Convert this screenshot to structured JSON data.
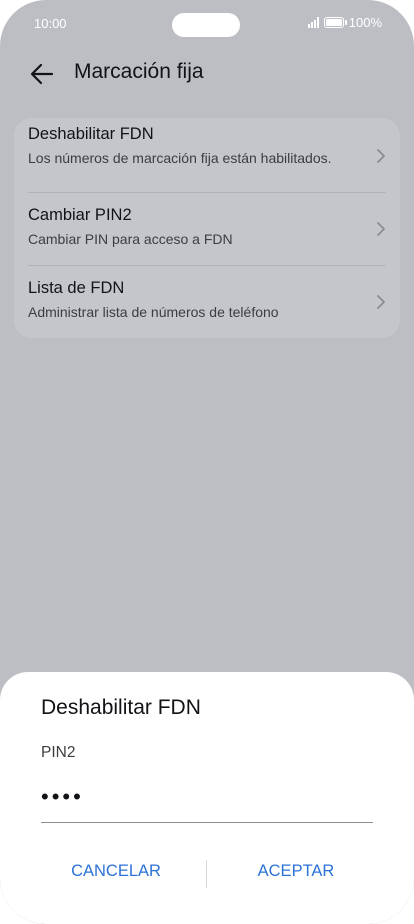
{
  "status_bar": {
    "time": "10:00",
    "battery": "100%"
  },
  "header": {
    "title": "Marcación fija",
    "back_icon": "arrow-left-icon"
  },
  "settings": {
    "items": [
      {
        "title": "Deshabilitar FDN",
        "subtitle": "Los números de marcación fija están habilitados."
      },
      {
        "title": "Cambiar PIN2",
        "subtitle": "Cambiar PIN para acceso a FDN"
      },
      {
        "title": "Lista de FDN",
        "subtitle": "Administrar lista de números de teléfono"
      }
    ]
  },
  "dialog": {
    "title": "Deshabilitar FDN",
    "field_label": "PIN2",
    "field_value": "••••",
    "cancel_label": "CANCELAR",
    "accept_label": "ACEPTAR"
  },
  "colors": {
    "accent": "#2c72d8",
    "overlay": "#bcbec3"
  }
}
